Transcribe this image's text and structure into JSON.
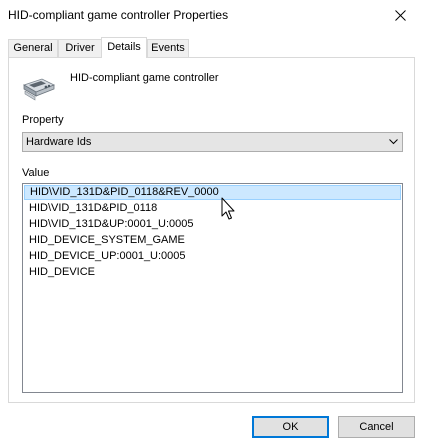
{
  "window": {
    "title": "HID-compliant game controller Properties"
  },
  "tabs": [
    {
      "label": "General",
      "active": false
    },
    {
      "label": "Driver",
      "active": false
    },
    {
      "label": "Details",
      "active": true
    },
    {
      "label": "Events",
      "active": false
    }
  ],
  "details": {
    "device_name": "HID-compliant game controller",
    "device_icon": "game-controller-icon",
    "property_label": "Property",
    "property_selected": "Hardware Ids",
    "value_label": "Value",
    "values": [
      "HID\\VID_131D&PID_0118&REV_0000",
      "HID\\VID_131D&PID_0118",
      "HID\\VID_131D&UP:0001_U:0005",
      "HID_DEVICE_SYSTEM_GAME",
      "HID_DEVICE_UP:0001_U:0005",
      "HID_DEVICE"
    ],
    "selected_index": 0
  },
  "buttons": {
    "ok": "OK",
    "cancel": "Cancel"
  },
  "colors": {
    "selection_bg": "#cce8ff",
    "selection_border": "#99d1ff",
    "default_button_border": "#0078d7"
  }
}
